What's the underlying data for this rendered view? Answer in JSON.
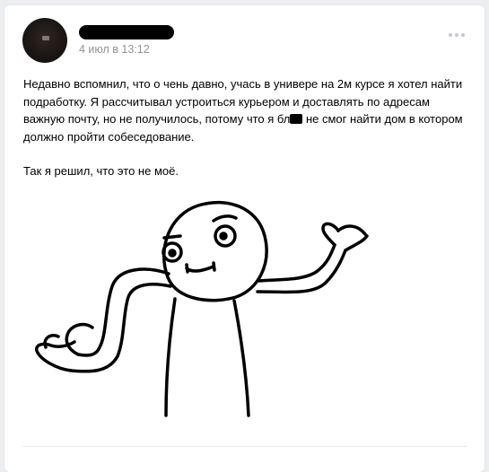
{
  "post": {
    "author_name_redacted": true,
    "date": "4 июл в 13:12",
    "text_p1_before": "Недавно вспомнил, что о чень давно, учась в универе на 2м курсе я хотел найти подработку. Я рассчитывал устроиться курьером и доставлять по адресам важную почту, но не получилось, потому что я бл",
    "text_p1_after": " не смог найти дом в котором должно пройти собеседование.",
    "text_p2": "Так я решил, что это не моё.",
    "image_icon": "shrug-meme-image",
    "more_icon": "more-dots-icon"
  }
}
